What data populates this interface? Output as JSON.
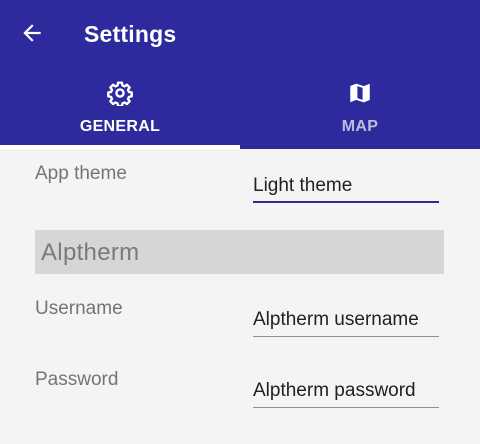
{
  "header": {
    "title": "Settings",
    "background_color": "#2c2a9c",
    "back_icon": "arrow-left-icon"
  },
  "tabs": [
    {
      "label": "GENERAL",
      "icon": "gear-icon",
      "selected": true
    },
    {
      "label": "MAP",
      "icon": "map-icon",
      "selected": false
    }
  ],
  "general": {
    "app_theme": {
      "label": "App theme",
      "value": "Light theme"
    },
    "section_title": "Alptherm",
    "username": {
      "label": "Username",
      "placeholder": "Alptherm username"
    },
    "password": {
      "label": "Password",
      "placeholder": "Alptherm password"
    }
  }
}
